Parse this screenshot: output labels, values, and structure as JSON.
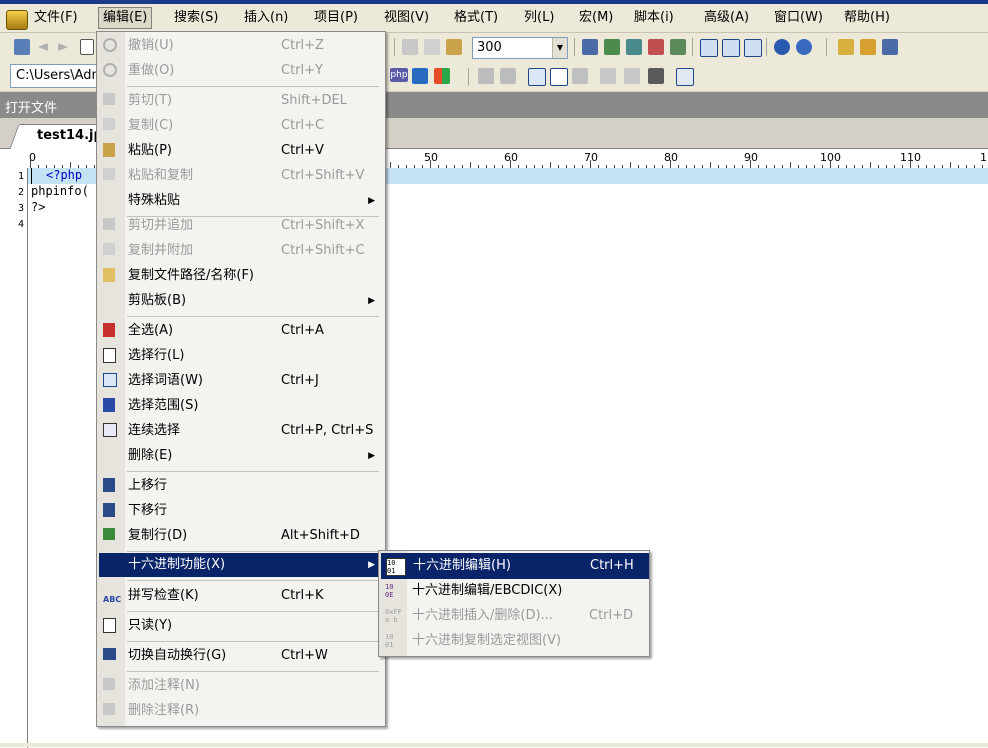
{
  "menubar": {
    "items": [
      "文件(F)",
      "编辑(E)",
      "搜索(S)",
      "插入(n)",
      "项目(P)",
      "视图(V)",
      "格式(T)",
      "列(L)",
      "宏(M)",
      "脚本(i)",
      "高级(A)",
      "窗口(W)",
      "帮助(H)"
    ]
  },
  "toolbar": {
    "zoom_value": "300",
    "path": "C:\\Users\\Adm",
    "php_label": "php"
  },
  "open_file_label": "打开文件",
  "file_tab": "test14.jpg",
  "ruler": {
    "zero": "0",
    "numbers": [
      "50",
      "60",
      "70",
      "80",
      "90",
      "100",
      "110",
      "1"
    ]
  },
  "editor": {
    "line_numbers": [
      "1",
      "2",
      "3",
      "4"
    ],
    "lines": [
      "<?php",
      "phpinfo(",
      "?>",
      ""
    ]
  },
  "edit_menu": {
    "items": [
      {
        "label": "撤销(U)",
        "shortcut": "Ctrl+Z",
        "enabled": false
      },
      {
        "label": "重做(O)",
        "shortcut": "Ctrl+Y",
        "enabled": false
      },
      {
        "label": "剪切(T)",
        "shortcut": "Shift+DEL",
        "enabled": false
      },
      {
        "label": "复制(C)",
        "shortcut": "Ctrl+C",
        "enabled": false
      },
      {
        "label": "粘贴(P)",
        "shortcut": "Ctrl+V",
        "enabled": true
      },
      {
        "label": "粘贴和复制",
        "shortcut": "Ctrl+Shift+V",
        "enabled": false
      },
      {
        "label": "特殊粘贴",
        "shortcut": "",
        "enabled": true,
        "submenu": true
      },
      {
        "label": "剪切并追加",
        "shortcut": "Ctrl+Shift+X",
        "enabled": false
      },
      {
        "label": "复制并附加",
        "shortcut": "Ctrl+Shift+C",
        "enabled": false
      },
      {
        "label": "复制文件路径/名称(F)",
        "shortcut": "",
        "enabled": true
      },
      {
        "label": "剪贴板(B)",
        "shortcut": "",
        "enabled": true,
        "submenu": true
      },
      {
        "label": "全选(A)",
        "shortcut": "Ctrl+A",
        "enabled": true
      },
      {
        "label": "选择行(L)",
        "shortcut": "",
        "enabled": true
      },
      {
        "label": "选择词语(W)",
        "shortcut": "Ctrl+J",
        "enabled": true
      },
      {
        "label": "选择范围(S)",
        "shortcut": "",
        "enabled": true
      },
      {
        "label": "连续选择",
        "shortcut": "Ctrl+P, Ctrl+S",
        "enabled": true
      },
      {
        "label": "删除(E)",
        "shortcut": "",
        "enabled": true,
        "submenu": true
      },
      {
        "label": "上移行",
        "shortcut": "",
        "enabled": true
      },
      {
        "label": "下移行",
        "shortcut": "",
        "enabled": true
      },
      {
        "label": "复制行(D)",
        "shortcut": "Alt+Shift+D",
        "enabled": true
      },
      {
        "label": "十六进制功能(X)",
        "shortcut": "",
        "enabled": true,
        "submenu": true,
        "highlight": true
      },
      {
        "label": "拼写检查(K)",
        "shortcut": "Ctrl+K",
        "enabled": true
      },
      {
        "label": "只读(Y)",
        "shortcut": "",
        "enabled": true
      },
      {
        "label": "切换自动换行(G)",
        "shortcut": "Ctrl+W",
        "enabled": true
      },
      {
        "label": "添加注释(N)",
        "shortcut": "",
        "enabled": false
      },
      {
        "label": "删除注释(R)",
        "shortcut": "",
        "enabled": false
      }
    ]
  },
  "hex_submenu": {
    "items": [
      {
        "label": "十六进制编辑(H)",
        "shortcut": "Ctrl+H",
        "enabled": true,
        "highlight": true
      },
      {
        "label": "十六进制编辑/EBCDIC(X)",
        "shortcut": "",
        "enabled": true
      },
      {
        "label": "十六进制插入/删除(D)...",
        "shortcut": "Ctrl+D",
        "enabled": false
      },
      {
        "label": "十六进制复制选定视图(V)",
        "shortcut": "",
        "enabled": false
      }
    ]
  }
}
